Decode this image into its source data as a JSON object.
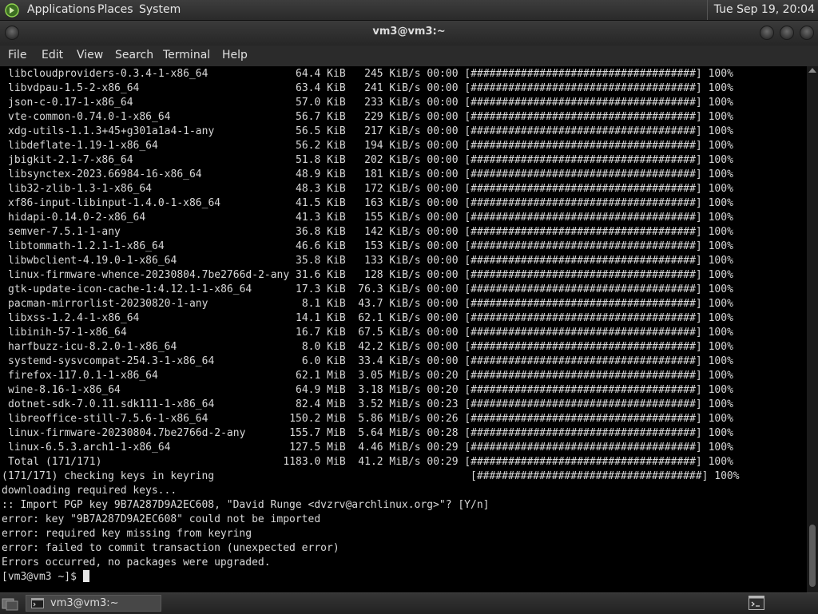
{
  "top_panel": {
    "menus": [
      "Applications",
      "Places",
      "System"
    ],
    "clock": "Tue Sep 19, 20:04"
  },
  "window": {
    "title": "vm3@vm3:~",
    "menu": [
      "File",
      "Edit",
      "View",
      "Search",
      "Terminal",
      "Help"
    ]
  },
  "terminal": {
    "lines": [
      "libcloudproviders-0.3.4-1-x86_64              64.4 KiB   245 KiB/s 00:00 [####################################] 100%",
      "libvdpau-1.5-2-x86_64                         63.4 KiB   241 KiB/s 00:00 [####################################] 100%",
      "json-c-0.17-1-x86_64                          57.0 KiB   233 KiB/s 00:00 [####################################] 100%",
      "vte-common-0.74.0-1-x86_64                    56.7 KiB   229 KiB/s 00:00 [####################################] 100%",
      "xdg-utils-1.1.3+45+g301a1a4-1-any             56.5 KiB   217 KiB/s 00:00 [####################################] 100%",
      "libdeflate-1.19-1-x86_64                      56.2 KiB   194 KiB/s 00:00 [####################################] 100%",
      "jbigkit-2.1-7-x86_64                          51.8 KiB   202 KiB/s 00:00 [####################################] 100%",
      "libsynctex-2023.66984-16-x86_64               48.9 KiB   181 KiB/s 00:00 [####################################] 100%",
      "lib32-zlib-1.3-1-x86_64                       48.3 KiB   172 KiB/s 00:00 [####################################] 100%",
      "xf86-input-libinput-1.4.0-1-x86_64            41.5 KiB   163 KiB/s 00:00 [####################################] 100%",
      "hidapi-0.14.0-2-x86_64                        41.3 KiB   155 KiB/s 00:00 [####################################] 100%",
      "semver-7.5.1-1-any                            36.8 KiB   142 KiB/s 00:00 [####################################] 100%",
      "libtommath-1.2.1-1-x86_64                     46.6 KiB   153 KiB/s 00:00 [####################################] 100%",
      "libwbclient-4.19.0-1-x86_64                   35.8 KiB   133 KiB/s 00:00 [####################################] 100%",
      "linux-firmware-whence-20230804.7be2766d-2-any 31.6 KiB   128 KiB/s 00:00 [####################################] 100%",
      "gtk-update-icon-cache-1:4.12.1-1-x86_64       17.3 KiB  76.3 KiB/s 00:00 [####################################] 100%",
      "pacman-mirrorlist-20230820-1-any               8.1 KiB  43.7 KiB/s 00:00 [####################################] 100%",
      "libxss-1.2.4-1-x86_64                         14.1 KiB  62.1 KiB/s 00:00 [####################################] 100%",
      "libinih-57-1-x86_64                           16.7 KiB  67.5 KiB/s 00:00 [####################################] 100%",
      "harfbuzz-icu-8.2.0-1-x86_64                    8.0 KiB  42.2 KiB/s 00:00 [####################################] 100%",
      "systemd-sysvcompat-254.3-1-x86_64              6.0 KiB  33.4 KiB/s 00:00 [####################################] 100%",
      "firefox-117.0.1-1-x86_64                      62.1 MiB  3.05 MiB/s 00:20 [####################################] 100%",
      "wine-8.16-1-x86_64                            64.9 MiB  3.18 MiB/s 00:20 [####################################] 100%",
      "dotnet-sdk-7.0.11.sdk111-1-x86_64             82.4 MiB  3.52 MiB/s 00:23 [####################################] 100%",
      "libreoffice-still-7.5.6-1-x86_64             150.2 MiB  5.86 MiB/s 00:26 [####################################] 100%",
      "linux-firmware-20230804.7be2766d-2-any       155.7 MiB  5.64 MiB/s 00:28 [####################################] 100%",
      "linux-6.5.3.arch1-1-x86_64                   127.5 MiB  4.46 MiB/s 00:29 [####################################] 100%",
      "Total (171/171)                             1183.0 MiB  41.2 MiB/s 00:29 [####################################] 100%",
      "(171/171) checking keys in keyring                                         [####################################] 100%",
      "downloading required keys...",
      ":: Import PGP key 9B7A287D9A2EC608, \"David Runge <dvzrv@archlinux.org>\"? [Y/n]",
      "error: key \"9B7A287D9A2EC608\" could not be imported",
      "error: required key missing from keyring",
      "error: failed to commit transaction (unexpected error)",
      "Errors occurred, no packages were upgraded.",
      "[vm3@vm3 ~]$ "
    ]
  },
  "taskbar": {
    "task_label": "vm3@vm3:~"
  },
  "icons": {
    "distro": "distro-logo-icon",
    "show_desktop": "show-desktop-icon",
    "task": "terminal-icon",
    "tray": "terminal-tray-icon"
  }
}
